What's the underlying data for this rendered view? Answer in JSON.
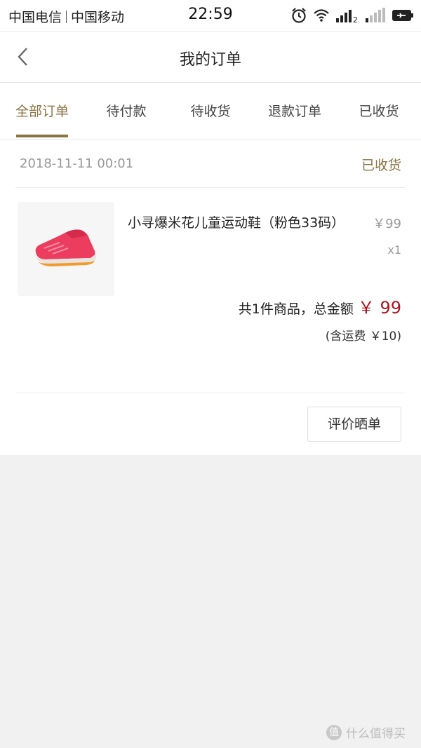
{
  "statusbar": {
    "carrier1": "中国电信",
    "carrier2": "中国移动",
    "time": "22:59",
    "network_badge": "2"
  },
  "navbar": {
    "title": "我的订单"
  },
  "tabs": [
    {
      "label": "全部订单",
      "active": true
    },
    {
      "label": "待付款",
      "active": false
    },
    {
      "label": "待收货",
      "active": false
    },
    {
      "label": "退款订单",
      "active": false
    },
    {
      "label": "已收货",
      "active": false
    }
  ],
  "order": {
    "date": "2018-11-11 00:01",
    "status": "已收货",
    "product": {
      "name": "小寻爆米花儿童运动鞋（粉色33码）",
      "price": "￥99",
      "quantity": "x1"
    },
    "summary_text": "共1件商品，总金额",
    "total_amount": "￥ 99",
    "shipping_note": "(含运费 ￥10)",
    "review_button": "评价晒单"
  },
  "watermark": {
    "icon_char": "值",
    "text": "什么值得买"
  },
  "colors": {
    "accent": "#8b7444",
    "price_red": "#b0141d",
    "background": "#f1f1f1"
  }
}
